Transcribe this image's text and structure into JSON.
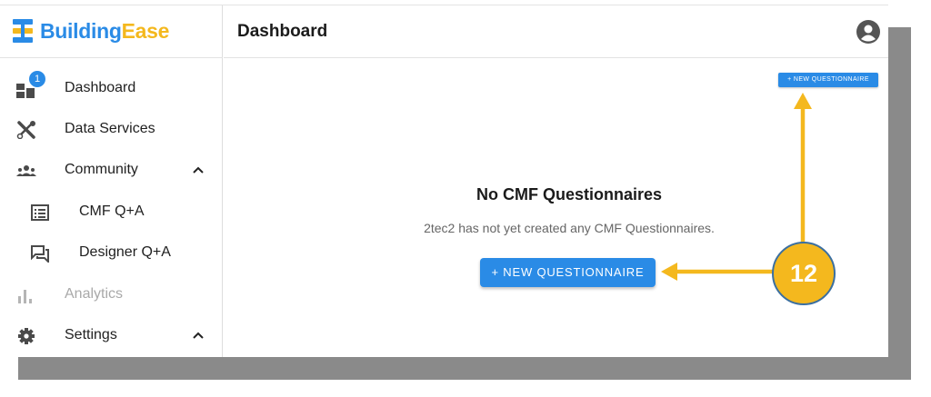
{
  "brand": {
    "name_part1": "Building",
    "name_part2": "Ease"
  },
  "header": {
    "title": "Dashboard"
  },
  "sidebar": {
    "items": [
      {
        "label": "Dashboard",
        "badge": "1"
      },
      {
        "label": "Data Services"
      },
      {
        "label": "Community"
      },
      {
        "label": "CMF Q+A"
      },
      {
        "label": "Designer Q+A"
      },
      {
        "label": "Analytics"
      },
      {
        "label": "Settings"
      }
    ]
  },
  "main": {
    "top_button_label": "+ NEW QUESTIONNAIRE",
    "empty_title": "No CMF Questionnaires",
    "empty_description": "2tec2 has not yet created any CMF Questionnaires.",
    "new_button_label": "+ NEW QUESTIONNAIRE"
  },
  "annotation": {
    "step_number": "12"
  },
  "colors": {
    "primary": "#2a8be6",
    "brand_accent": "#f4b81e",
    "callout_border": "#3b6fa0"
  }
}
